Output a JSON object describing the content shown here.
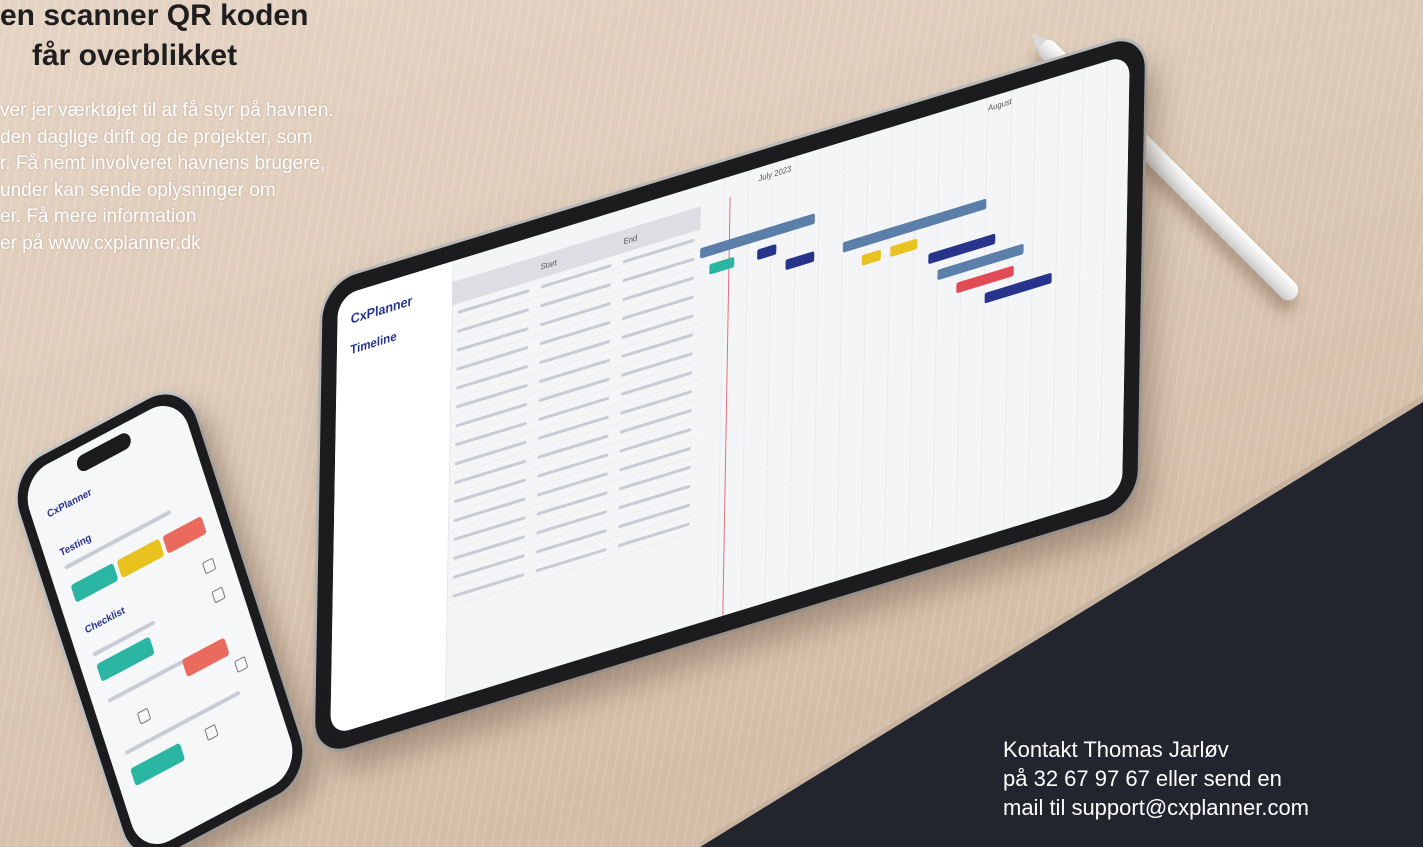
{
  "headline": {
    "line1": "en scanner QR koden",
    "line2": "får overblikket"
  },
  "body_copy": {
    "line1": "ver jer værktøjet til at få styr på havnen.",
    "line2": "den daglige drift og de projekter, som",
    "line3": "r. Få nemt involveret havnens brugere,",
    "line4": "under kan sende oplysninger om",
    "line5": "er. Få mere information",
    "line6": "er på www.cxplanner.dk"
  },
  "contact": {
    "line1": "Kontakt Thomas Jarløv",
    "line2": "på 32 67 97 67 eller send en",
    "line3": "mail til support@cxplanner.com"
  },
  "tablet": {
    "logo": "CxPlanner",
    "title": "Timeline",
    "col_name": "",
    "col_start": "Start",
    "col_end": "End",
    "months": [
      "July 2023",
      "August"
    ],
    "rows": [
      "",
      "",
      "",
      "",
      "",
      "",
      "",
      "",
      "",
      "",
      "",
      "",
      "",
      "",
      "",
      ""
    ]
  },
  "phone": {
    "logo": "CxPlanner",
    "heading_testing": "Testing",
    "heading_checklist": "Checklist"
  },
  "colors": {
    "navy": "#27348b",
    "steel": "#5b7fa8",
    "teal": "#2bb5a3",
    "yellow": "#e8c21e",
    "red": "#e24a56",
    "coral": "#ea6b5e"
  }
}
